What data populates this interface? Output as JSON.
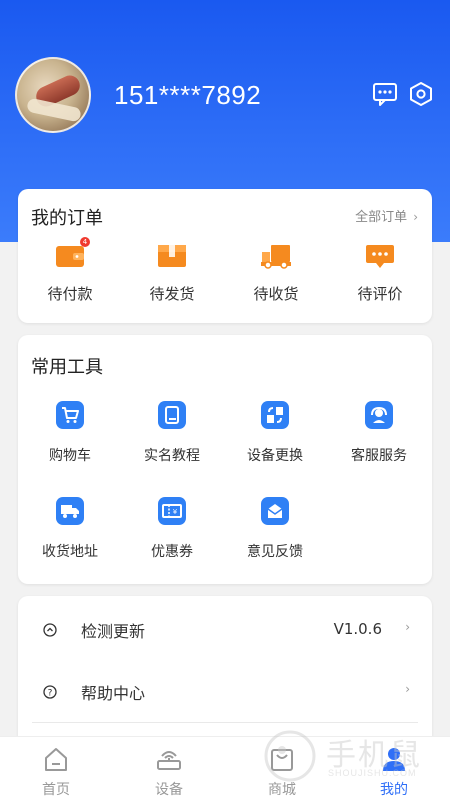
{
  "profile": {
    "phone": "151****7892",
    "avatar_icon": "avatar-photo",
    "message_icon": "chat-bubble-icon",
    "settings_icon": "hexagon-gear-icon"
  },
  "orders": {
    "title": "我的订单",
    "all_link": "全部订单",
    "items": [
      {
        "label": "待付款",
        "icon": "wallet-icon",
        "badge": "4",
        "color": "#f58a1f"
      },
      {
        "label": "待发货",
        "icon": "package-icon",
        "badge": "",
        "color": "#f58a1f"
      },
      {
        "label": "待收货",
        "icon": "truck-icon",
        "badge": "",
        "color": "#f58a1f"
      },
      {
        "label": "待评价",
        "icon": "comment-icon",
        "badge": "",
        "color": "#f58a1f"
      }
    ]
  },
  "tools": {
    "title": "常用工具",
    "items": [
      {
        "label": "购物车",
        "icon": "cart-icon"
      },
      {
        "label": "实名教程",
        "icon": "book-icon"
      },
      {
        "label": "设备更换",
        "icon": "swap-device-icon"
      },
      {
        "label": "客服服务",
        "icon": "headset-icon"
      },
      {
        "label": "收货地址",
        "icon": "delivery-truck-icon"
      },
      {
        "label": "优惠券",
        "icon": "coupon-icon"
      },
      {
        "label": "意见反馈",
        "icon": "feedback-envelope-icon"
      }
    ],
    "icon_color": "#2f80f5"
  },
  "settings_list": {
    "rows": [
      {
        "label": "检测更新",
        "value": "V1.0.6",
        "icon": "update-icon"
      },
      {
        "label": "帮助中心",
        "value": "",
        "icon": "help-icon"
      }
    ]
  },
  "tabbar": {
    "tabs": [
      {
        "label": "首页",
        "icon": "home-icon",
        "active": false
      },
      {
        "label": "设备",
        "icon": "router-icon",
        "active": false
      },
      {
        "label": "商城",
        "icon": "shopping-bag-icon",
        "active": false
      },
      {
        "label": "我的",
        "icon": "user-icon",
        "active": true
      }
    ],
    "active_color": "#2f6ff7"
  },
  "watermark": {
    "text": "手机鼠",
    "sub": "SHOUJISHU.COM"
  },
  "colors": {
    "brand_blue": "#1a59f0",
    "order_orange": "#f58a1f",
    "badge_red": "#f03a2f"
  }
}
